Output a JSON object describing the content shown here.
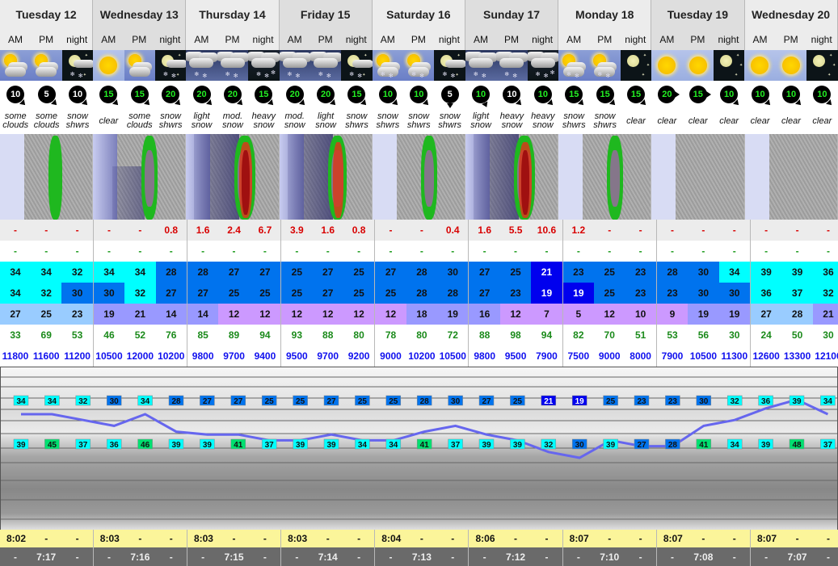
{
  "days": [
    {
      "label": "Tuesday 12",
      "shade": "norm"
    },
    {
      "label": "Wednesday 13",
      "shade": "alt"
    },
    {
      "label": "Thursday 14",
      "shade": "norm"
    },
    {
      "label": "Friday 15",
      "shade": "alt"
    },
    {
      "label": "Saturday 16",
      "shade": "norm"
    },
    {
      "label": "Sunday 17",
      "shade": "alt"
    },
    {
      "label": "Monday 18",
      "shade": "norm"
    },
    {
      "label": "Tuesday 19",
      "shade": "alt"
    },
    {
      "label": "Wednesday 20",
      "shade": "norm"
    }
  ],
  "periods": [
    "AM",
    "PM",
    "night"
  ],
  "weather_icons": [
    "sun-cloud-icon",
    "sun-cloud-icon",
    "moon-cloud-snow-icon",
    "sun-icon",
    "sun-cloud-icon",
    "moon-cloud-snow-icon",
    "cloud-snow-icon",
    "cloud-snow-icon",
    "cloud-snow-night-icon",
    "cloud-snow-icon",
    "cloud-snow-icon",
    "moon-cloud-snow-icon",
    "sun-cloud-snow-icon",
    "sun-cloud-snow-icon",
    "moon-cloud-snow-icon",
    "cloud-snow-icon",
    "cloud-snow-icon",
    "cloud-snow-night-icon",
    "sun-cloud-snow-icon",
    "sun-cloud-snow-icon",
    "moon-icon",
    "sun-icon",
    "sun-icon",
    "moon-icon",
    "sun-icon",
    "sun-icon",
    "moon-icon"
  ],
  "wind": [
    {
      "speed": "10",
      "color": "w",
      "dir": "sw"
    },
    {
      "speed": "5",
      "color": "w",
      "dir": "sw"
    },
    {
      "speed": "10",
      "color": "w",
      "dir": "sw"
    },
    {
      "speed": "15",
      "color": "g",
      "dir": "sw"
    },
    {
      "speed": "15",
      "color": "g",
      "dir": "sw"
    },
    {
      "speed": "20",
      "color": "g",
      "dir": "sw"
    },
    {
      "speed": "20",
      "color": "g",
      "dir": "sw"
    },
    {
      "speed": "20",
      "color": "g",
      "dir": "sw"
    },
    {
      "speed": "15",
      "color": "g",
      "dir": "sw"
    },
    {
      "speed": "20",
      "color": "g",
      "dir": "sw"
    },
    {
      "speed": "20",
      "color": "g",
      "dir": "sw"
    },
    {
      "speed": "15",
      "color": "g",
      "dir": "sw"
    },
    {
      "speed": "10",
      "color": "g",
      "dir": "sw"
    },
    {
      "speed": "10",
      "color": "g",
      "dir": "sw"
    },
    {
      "speed": "5",
      "color": "w",
      "dir": "s"
    },
    {
      "speed": "10",
      "color": "g",
      "dir": "ssw"
    },
    {
      "speed": "10",
      "color": "w",
      "dir": "sw"
    },
    {
      "speed": "10",
      "color": "g",
      "dir": "sw"
    },
    {
      "speed": "15",
      "color": "g",
      "dir": "sw"
    },
    {
      "speed": "15",
      "color": "g",
      "dir": "sw"
    },
    {
      "speed": "15",
      "color": "g",
      "dir": "sw"
    },
    {
      "speed": "20",
      "color": "g",
      "dir": "w"
    },
    {
      "speed": "15",
      "color": "g",
      "dir": "w"
    },
    {
      "speed": "10",
      "color": "g",
      "dir": "sw"
    },
    {
      "speed": "10",
      "color": "g",
      "dir": "sw"
    },
    {
      "speed": "10",
      "color": "g",
      "dir": "sw"
    },
    {
      "speed": "10",
      "color": "g",
      "dir": "sw"
    }
  ],
  "descriptions": [
    [
      "some",
      "clouds"
    ],
    [
      "some",
      "clouds"
    ],
    [
      "snow",
      "shwrs"
    ],
    [
      "clear"
    ],
    [
      "some",
      "clouds"
    ],
    [
      "snow",
      "shwrs"
    ],
    [
      "light",
      "snow"
    ],
    [
      "mod.",
      "snow"
    ],
    [
      "heavy",
      "snow"
    ],
    [
      "mod.",
      "snow"
    ],
    [
      "light",
      "snow"
    ],
    [
      "snow",
      "shwrs"
    ],
    [
      "snow",
      "shwrs"
    ],
    [
      "snow",
      "shwrs"
    ],
    [
      "snow",
      "shwrs"
    ],
    [
      "light",
      "snow"
    ],
    [
      "heavy",
      "snow"
    ],
    [
      "heavy",
      "snow"
    ],
    [
      "snow",
      "shwrs"
    ],
    [
      "snow",
      "shwrs"
    ],
    [
      "clear"
    ],
    [
      "clear"
    ],
    [
      "clear"
    ],
    [
      "clear"
    ],
    [
      "clear"
    ],
    [
      "clear"
    ],
    [
      "clear"
    ]
  ],
  "maps": [
    {
      "intensity": 1,
      "shade": 0
    },
    {
      "intensity": 2,
      "shade": 1
    },
    {
      "intensity": 4,
      "shade": 2
    },
    {
      "intensity": 3,
      "shade": 2
    },
    {
      "intensity": 2,
      "shade": 0
    },
    {
      "intensity": 4,
      "shade": 2
    },
    {
      "intensity": 2,
      "shade": 0
    },
    {
      "intensity": 0,
      "shade": 0
    },
    {
      "intensity": 0,
      "shade": 0
    }
  ],
  "rows": {
    "precip": [
      "-",
      "-",
      "-",
      "-",
      "-",
      "0.8",
      "1.6",
      "2.4",
      "6.7",
      "3.9",
      "1.6",
      "0.8",
      "-",
      "-",
      "0.4",
      "1.6",
      "5.5",
      "10.6",
      "1.2",
      "-",
      "-",
      "-",
      "-",
      "-",
      "-",
      "-",
      "-"
    ],
    "snow": [
      "-",
      "-",
      "-",
      "-",
      "-",
      "-",
      "-",
      "-",
      "-",
      "-",
      "-",
      "-",
      "-",
      "-",
      "-",
      "-",
      "-",
      "-",
      "-",
      "-",
      "-",
      "-",
      "-",
      "-",
      "-",
      "-",
      "-"
    ],
    "temp_max": [
      "34",
      "34",
      "32",
      "34",
      "34",
      "28",
      "28",
      "27",
      "27",
      "25",
      "27",
      "25",
      "27",
      "28",
      "30",
      "27",
      "25",
      "21",
      "23",
      "25",
      "23",
      "28",
      "30",
      "34",
      "39",
      "39",
      "36"
    ],
    "temp_min": [
      "34",
      "32",
      "30",
      "30",
      "32",
      "27",
      "27",
      "25",
      "25",
      "25",
      "27",
      "25",
      "25",
      "28",
      "28",
      "27",
      "23",
      "19",
      "19",
      "25",
      "23",
      "23",
      "30",
      "30",
      "36",
      "37",
      "32"
    ],
    "wind_chill": [
      "27",
      "25",
      "23",
      "19",
      "21",
      "14",
      "14",
      "12",
      "12",
      "12",
      "12",
      "12",
      "12",
      "18",
      "19",
      "16",
      "12",
      "7",
      "5",
      "12",
      "10",
      "9",
      "19",
      "19",
      "27",
      "28",
      "21"
    ],
    "humidity": [
      "33",
      "69",
      "53",
      "46",
      "52",
      "76",
      "85",
      "89",
      "94",
      "93",
      "88",
      "80",
      "78",
      "80",
      "72",
      "88",
      "98",
      "94",
      "82",
      "70",
      "51",
      "53",
      "56",
      "30",
      "24",
      "50",
      "30"
    ],
    "freezing_level": [
      "11800",
      "11600",
      "11200",
      "10500",
      "12000",
      "10200",
      "9800",
      "9700",
      "9400",
      "9500",
      "9700",
      "9200",
      "9000",
      "10200",
      "10500",
      "9800",
      "9500",
      "7900",
      "7500",
      "9000",
      "8000",
      "7900",
      "10500",
      "11300",
      "12600",
      "13300",
      "12100"
    ]
  },
  "colors": {
    "cyan": "#00ffff",
    "blue": "#0073ee",
    "darkblue": "#0000ee",
    "lightblue": "#99ccff",
    "lavender": "#9999ff",
    "violet": "#cc99ff",
    "green_label": "#00e070"
  },
  "graph": {
    "line_values": [
      "34",
      "34",
      "32",
      "30",
      "34",
      "28",
      "27",
      "27",
      "25",
      "25",
      "27",
      "25",
      "25",
      "28",
      "30",
      "27",
      "25",
      "21",
      "19",
      "25",
      "23",
      "23",
      "30",
      "32",
      "36",
      "39",
      "34"
    ],
    "lower_values": [
      "39",
      "45",
      "37",
      "36",
      "46",
      "39",
      "39",
      "41",
      "37",
      "39",
      "39",
      "34",
      "34",
      "41",
      "37",
      "39",
      "39",
      "32",
      "30",
      "39",
      "27",
      "28",
      "41",
      "34",
      "39",
      "48",
      "37"
    ]
  },
  "sunrise": [
    "8:02",
    "-",
    "-",
    "8:03",
    "-",
    "-",
    "8:03",
    "-",
    "-",
    "8:03",
    "-",
    "-",
    "8:04",
    "-",
    "-",
    "8:06",
    "-",
    "-",
    "8:07",
    "-",
    "-",
    "8:07",
    "-",
    "-",
    "8:07",
    "-",
    "-"
  ],
  "sunset": [
    "-",
    "7:17",
    "-",
    "-",
    "7:16",
    "-",
    "-",
    "7:15",
    "-",
    "-",
    "7:14",
    "-",
    "-",
    "7:13",
    "-",
    "-",
    "7:12",
    "-",
    "-",
    "7:10",
    "-",
    "-",
    "7:08",
    "-",
    "-",
    "7:07",
    "-"
  ]
}
